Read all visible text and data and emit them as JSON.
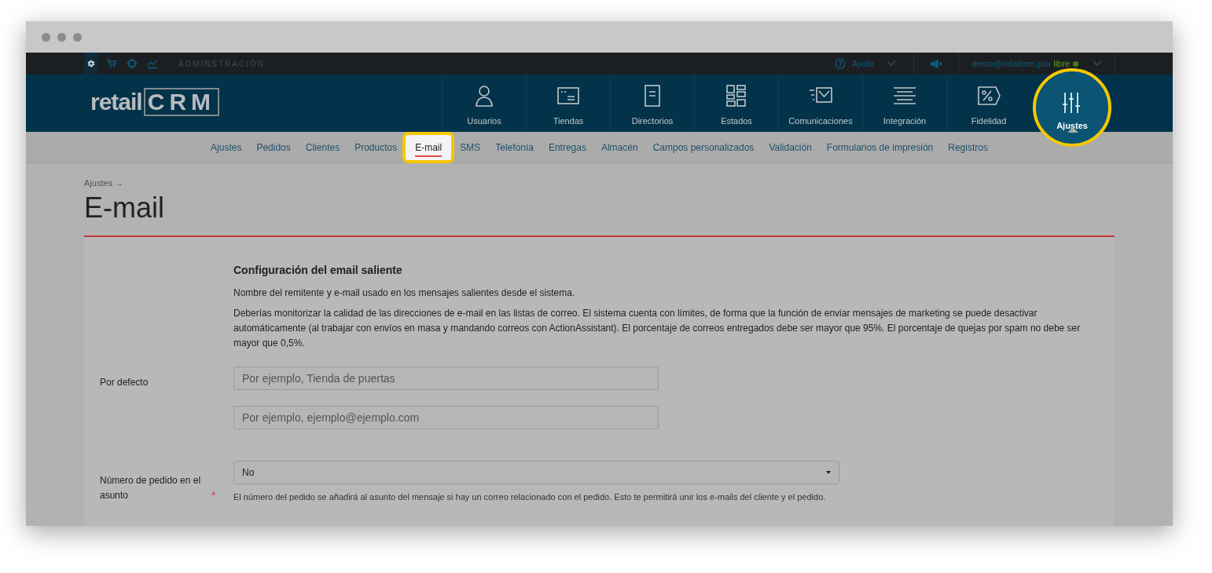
{
  "top_bar": {
    "section_tabs": [
      {
        "selected": true
      },
      {
        "selected": false
      },
      {
        "selected": false
      },
      {
        "selected": false
      }
    ],
    "section_title": "ADMINSTRACIÓN",
    "help": "Ayuda",
    "user_email": "demo@retailcrm.pro",
    "plan": "libre"
  },
  "header": {
    "logo": {
      "text": "retail",
      "mark": "CRM"
    },
    "nav": [
      {
        "label": "Usuarios",
        "selected": false
      },
      {
        "label": "Tiendas",
        "selected": false
      },
      {
        "label": "Directorios",
        "selected": false
      },
      {
        "label": "Estados",
        "selected": false
      },
      {
        "label": "Comunicaciones",
        "selected": false
      },
      {
        "label": "Integración",
        "selected": false
      },
      {
        "label": "Fidelidad",
        "selected": false
      },
      {
        "label": "Ajustes",
        "selected": true
      }
    ]
  },
  "subnav": [
    {
      "label": "Ajustes",
      "selected": false
    },
    {
      "label": "Pedidos",
      "selected": false
    },
    {
      "label": "Clientes",
      "selected": false
    },
    {
      "label": "Productos",
      "selected": false
    },
    {
      "label": "E-mail",
      "selected": true
    },
    {
      "label": "SMS",
      "selected": false
    },
    {
      "label": "Telefonía",
      "selected": false
    },
    {
      "label": "Entregas",
      "selected": false
    },
    {
      "label": "Almacén",
      "selected": false
    },
    {
      "label": "Campos personalizados",
      "selected": false
    },
    {
      "label": "Validación",
      "selected": false
    },
    {
      "label": "Formularios de impresión",
      "selected": false
    },
    {
      "label": "Registros",
      "selected": false
    }
  ],
  "breadcrumb": "Ajustes →",
  "page_title": "E-mail",
  "form": {
    "heading": "Configuración del email saliente",
    "description": "Nombre del remitente y e-mail usado en los mensajes salientes desde el sistema.",
    "notice": "Deberías monitorizar la calidad de las direcciones de e-mail en las listas de correo. El sistema cuenta con límites, de forma que la función de enviar mensajes de marketing se puede desactivar automáticamente (al trabajar con envíos en masa y mandando correos con ActionAssistant). El porcentaje de correos entregados debe ser mayor que 95%. El porcentaje de quejas por spam no debe ser mayor que 0,5%.",
    "fields": [
      {
        "kind": "text",
        "label": "Por defecto",
        "placeholder": "Por ejemplo, Tienda de puertas"
      },
      {
        "kind": "text",
        "placeholder": "Por ejemplo, ejemplo@ejemplo.com"
      },
      {
        "kind": "select",
        "label": "Número de pedido en el asunto",
        "required_mark": "*",
        "value": "No",
        "help": "El número del pedido se añadirá al asunto del mensaje si hay un correo relacionado con el pedido. Esto te permitirá unir los e-mails del cliente y el pedido."
      }
    ]
  }
}
